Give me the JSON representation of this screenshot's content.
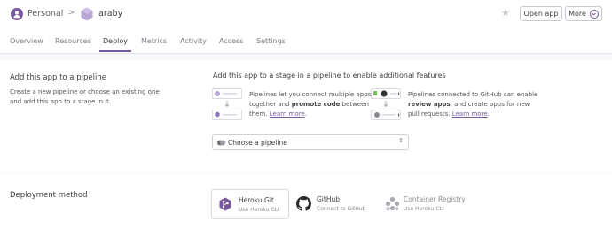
{
  "header": {
    "account": "Personal",
    "separator": ">",
    "app_name": "araby",
    "open_app_label": "Open app",
    "more_label": "More"
  },
  "tabs": [
    "Overview",
    "Resources",
    "Deploy",
    "Metrics",
    "Activity",
    "Access",
    "Settings"
  ],
  "active_tab": "Deploy",
  "pipeline": {
    "left_title": "Add this app to a pipeline",
    "left_desc": "Create a new pipeline or choose an existing one and add this app to a stage in it.",
    "right_title": "Add this app to a stage in a pipeline to enable additional features",
    "feature1": {
      "text_a": "Pipelines let you connect multiple apps together and ",
      "bold": "promote code",
      "text_b": " between them. ",
      "link": "Learn more",
      "end": "."
    },
    "feature2": {
      "text_a": "Pipelines connected to GitHub can enable ",
      "bold": "review apps",
      "text_b": ", and create apps for new pull requests. ",
      "link": "Learn more",
      "end": "."
    },
    "select_label": "Choose a pipeline"
  },
  "deployment": {
    "title": "Deployment method",
    "methods": [
      {
        "title": "Heroku Git",
        "subtitle": "Use Heroku CLI"
      },
      {
        "title": "GitHub",
        "subtitle": "Connect to GitHub"
      },
      {
        "title": "Container Registry",
        "subtitle": "Use Heroku CLI"
      }
    ]
  },
  "colors": {
    "accent": "#79589f",
    "text": "#3f3f44",
    "page_bg": "#f7f8fb"
  }
}
